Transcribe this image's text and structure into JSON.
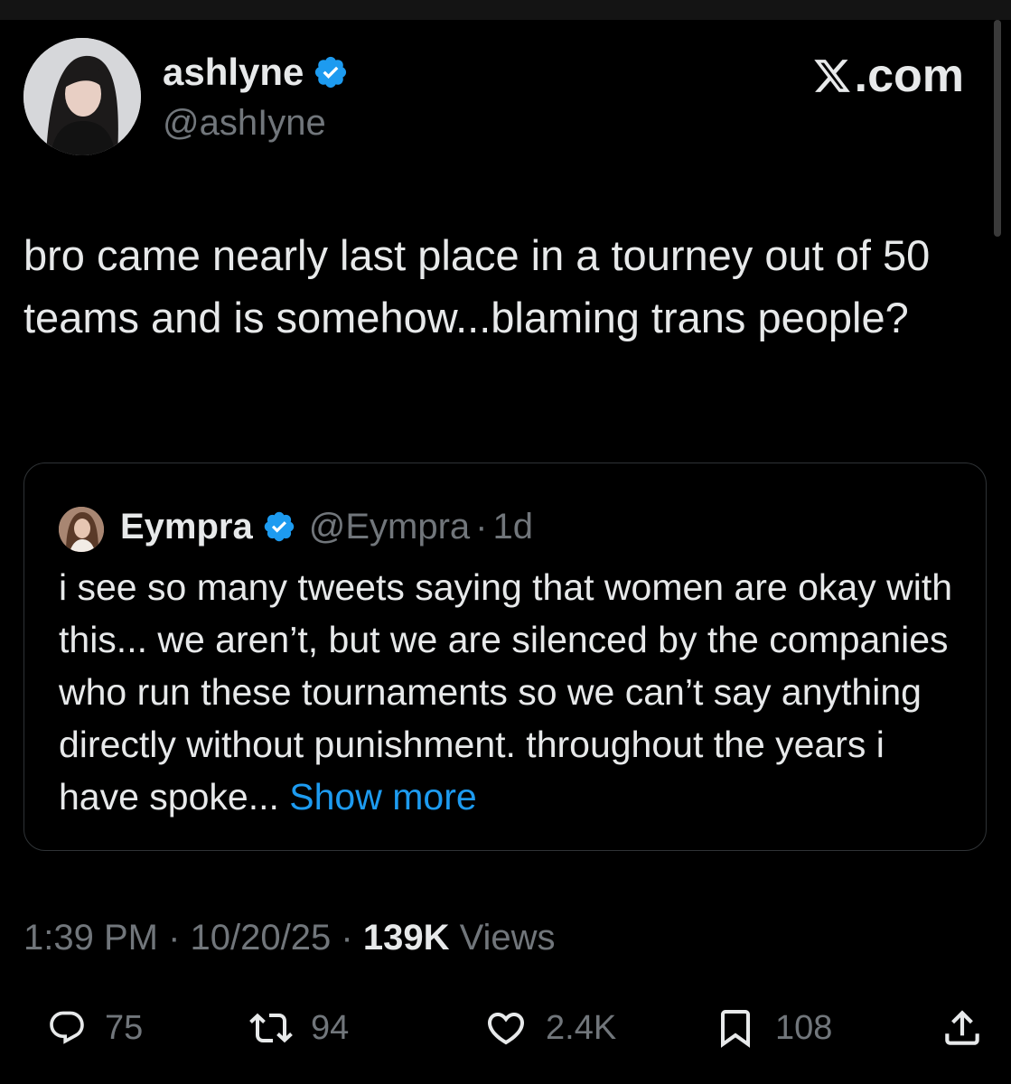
{
  "tweet": {
    "author": {
      "name": "ashlyne",
      "handle": "@ashIyne"
    },
    "brand": ".com",
    "text": "bro came nearly last place in a tourney out of 50 teams and is somehow...blaming trans people?",
    "quote": {
      "name": "Eympra",
      "handle": "@Eympra",
      "dot": "·",
      "time": "1d",
      "text": "i see so many tweets saying that women are okay with this... we aren’t, but we are silenced by the companies who run these tournaments so we can’t say anything directly without punishment. throughout the years i have spoke... ",
      "show_more": "Show more"
    },
    "meta": {
      "time": "1:39 PM",
      "date": "10/20/25",
      "views_count": "139K",
      "views_label": "Views",
      "separator": "·"
    },
    "actions": {
      "replies": "75",
      "reposts": "94",
      "likes": "2.4K",
      "bookmarks": "108"
    }
  },
  "colors": {
    "background": "#000000",
    "text": "#e7e9ea",
    "secondary": "#71767b",
    "accent": "#1d9bf0",
    "border": "#2f3336"
  },
  "icons": [
    "verified-badge-icon",
    "x-logo-icon",
    "reply-icon",
    "repost-icon",
    "like-icon",
    "bookmark-icon",
    "share-icon"
  ]
}
